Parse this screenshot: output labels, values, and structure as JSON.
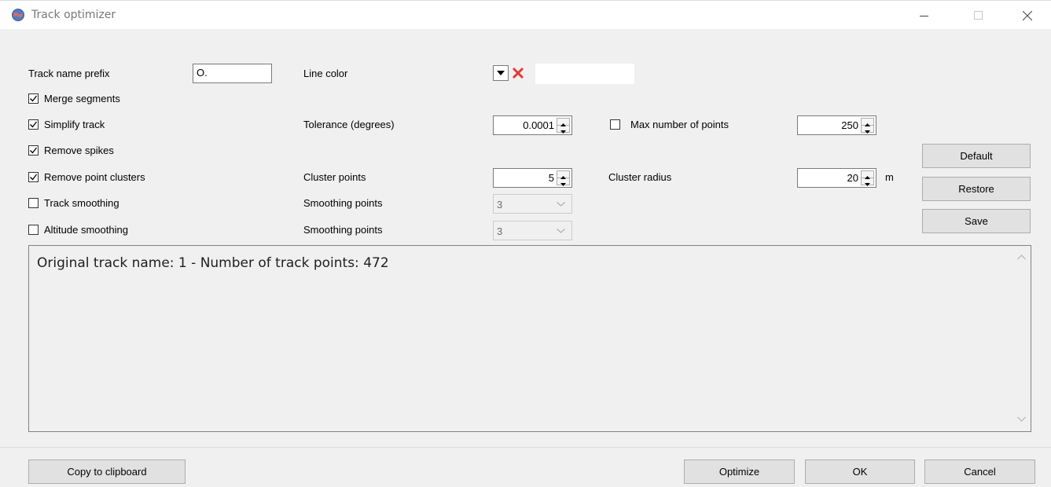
{
  "window": {
    "title": "Track optimizer",
    "icon": "app-icon",
    "controls": [
      "minimize",
      "maximize",
      "close"
    ]
  },
  "options": {
    "track_name_prefix_label": "Track name prefix",
    "track_name_prefix_value": "O.",
    "line_color_label": "Line color",
    "merge_segments": {
      "label": "Merge segments",
      "checked": true
    },
    "simplify_track": {
      "label": "Simplify track",
      "checked": true
    },
    "remove_spikes": {
      "label": "Remove spikes",
      "checked": true
    },
    "remove_point_clusters": {
      "label": "Remove point clusters",
      "checked": true
    },
    "track_smoothing": {
      "label": "Track smoothing",
      "checked": false
    },
    "altitude_smoothing": {
      "label": "Altitude smoothing",
      "checked": false
    },
    "tolerance_label": "Tolerance (degrees)",
    "tolerance_value": "0.0001",
    "max_points": {
      "label": "Max number of points",
      "checked": false,
      "value": "250"
    },
    "cluster_points_label": "Cluster points",
    "cluster_points_value": "5",
    "cluster_radius_label": "Cluster radius",
    "cluster_radius_value": "20",
    "cluster_radius_unit": "m",
    "track_smoothing_points_label": "Smoothing points",
    "track_smoothing_points_value": "3",
    "altitude_smoothing_points_label": "Smoothing points",
    "altitude_smoothing_points_value": "3"
  },
  "side_buttons": {
    "default": "Default",
    "restore": "Restore",
    "save": "Save"
  },
  "output": {
    "text": "Original track name: 1 - Number of track points: 472"
  },
  "footer": {
    "copy": "Copy to clipboard",
    "optimize": "Optimize",
    "ok": "OK",
    "cancel": "Cancel"
  },
  "colors": {
    "checkmark": "#000000",
    "clear_color_icon": "#e53935",
    "disabled_text": "#6d6d6d"
  }
}
